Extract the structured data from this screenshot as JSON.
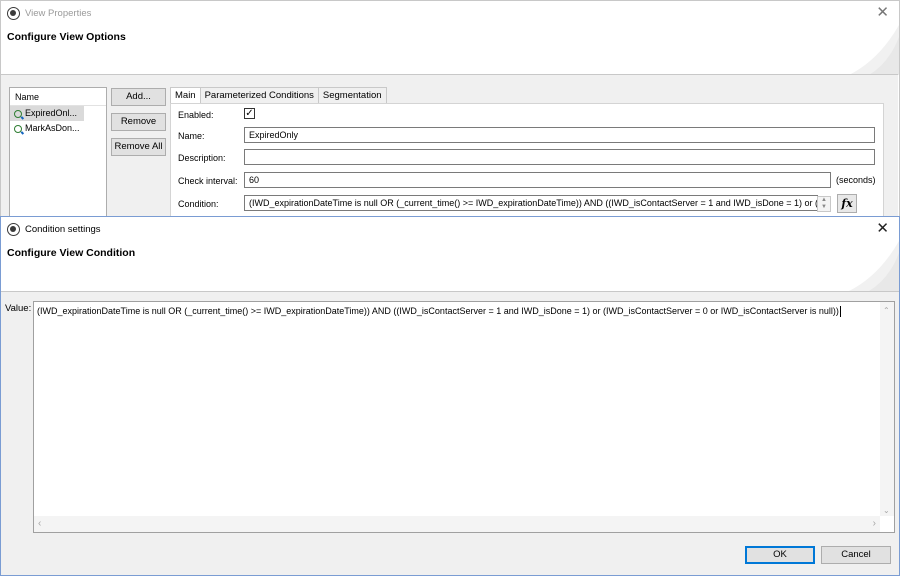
{
  "background_window": {
    "title": "View Properties",
    "banner_title": "Configure View Options",
    "list": {
      "header": "Name",
      "items": [
        "ExpiredOnl...",
        "MarkAsDon..."
      ]
    },
    "buttons": {
      "add": "Add...",
      "remove": "Remove",
      "remove_all": "Remove All"
    },
    "tabs": [
      "Main",
      "Parameterized Conditions",
      "Segmentation"
    ],
    "form": {
      "enabled_label": "Enabled:",
      "enabled_checked": "✓",
      "name_label": "Name:",
      "name_value": "ExpiredOnly",
      "description_label": "Description:",
      "description_value": "",
      "check_interval_label": "Check interval:",
      "check_interval_value": "60",
      "check_interval_units": "(seconds)",
      "condition_label": "Condition:",
      "condition_value": "(IWD_expirationDateTime is null OR (_current_time() >= IWD_expirationDateTime)) AND ((IWD_isContactServer = 1 and IWD_isDone = 1) or (",
      "fx_label": "fx"
    }
  },
  "dialog": {
    "title": "Condition settings",
    "banner_title": "Configure View Condition",
    "value_label": "Value:",
    "value_text": "(IWD_expirationDateTime is null OR (_current_time() >= IWD_expirationDateTime)) AND ((IWD_isContactServer = 1 and IWD_isDone = 1) or (IWD_isContactServer  = 0 or IWD_isContactServer is null))",
    "ok_label": "OK",
    "cancel_label": "Cancel"
  },
  "icons": {
    "app": "app-logo-icon",
    "close": "close-icon",
    "view_item": "view-search-icon"
  },
  "colors": {
    "dialog_border": "#7a9cd3",
    "default_button_border": "#0078d7",
    "panel_background": "#f0f0f0"
  }
}
